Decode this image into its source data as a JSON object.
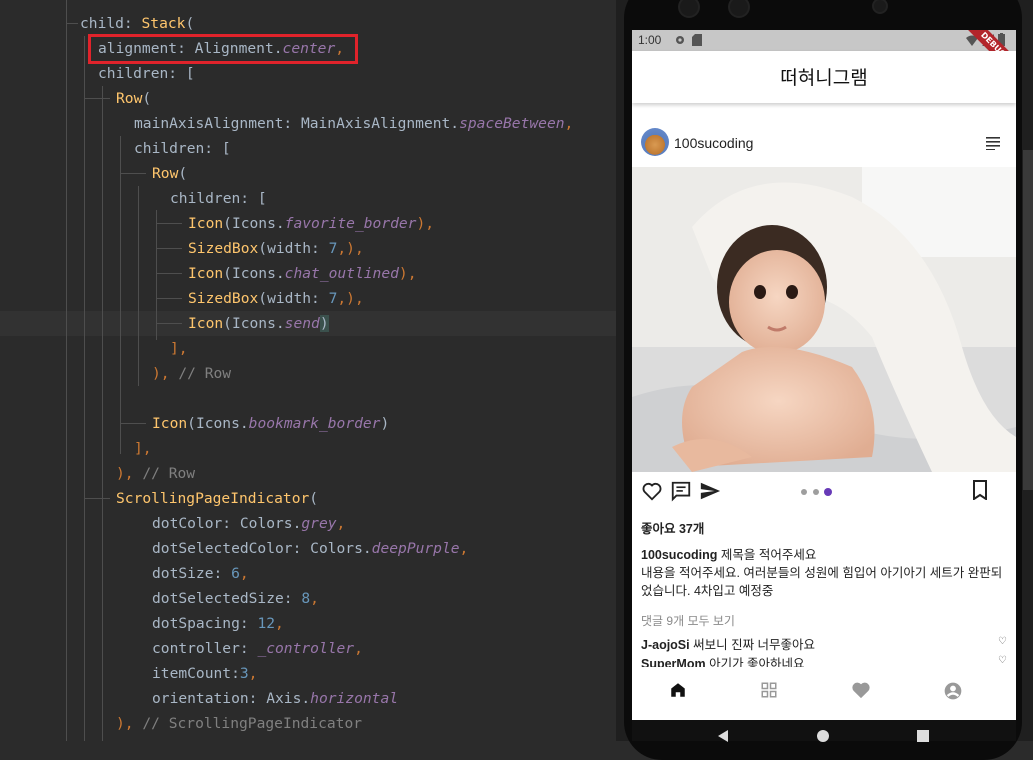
{
  "editor": {
    "lines": {
      "l1": {
        "prop": "child: ",
        "cls": "Stack",
        "rest": "("
      },
      "l2": {
        "prop": "alignment: ",
        "cls": "Alignment.",
        "it": "center",
        "rest": ","
      },
      "l3": {
        "prop": "children: ["
      },
      "l4": {
        "cls": "Row",
        "rest": "("
      },
      "l5": {
        "prop": "mainAxisAlignment: ",
        "cls": "MainAxisAlignment.",
        "it": "spaceBetween",
        "rest": ","
      },
      "l6": {
        "prop": "children: ["
      },
      "l7": {
        "cls": "Row",
        "rest": "("
      },
      "l8": {
        "prop": "children: ["
      },
      "l9": {
        "cls": "Icon",
        "a": "(Icons.",
        "it": "favorite_border",
        "rest": "),"
      },
      "l10": {
        "cls": "SizedBox",
        "a": "(width: ",
        "num": "7",
        "rest": ",),"
      },
      "l11": {
        "cls": "Icon",
        "a": "(Icons.",
        "it": "chat_outlined",
        "rest": "),"
      },
      "l12": {
        "cls": "SizedBox",
        "a": "(width: ",
        "num": "7",
        "rest": ",),"
      },
      "l13": {
        "cls": "Icon",
        "a": "(Icons.",
        "it": "send",
        "rest": ")"
      },
      "l14": {
        "rest": "],"
      },
      "l15": {
        "rest": "), ",
        "cm": "// Row"
      },
      "l17": {
        "cls": "Icon",
        "a": "(Icons.",
        "it": "bookmark_border",
        "rest": ")"
      },
      "l18": {
        "rest": "],"
      },
      "l19": {
        "rest": "), ",
        "cm": "// Row"
      },
      "l20": {
        "cls": "ScrollingPageIndicator",
        "rest": "("
      },
      "l21": {
        "prop": "dotColor: ",
        "a": "Colors.",
        "it": "grey",
        "rest": ","
      },
      "l22": {
        "prop": "dotSelectedColor: ",
        "a": "Colors.",
        "it": "deepPurple",
        "rest": ","
      },
      "l23": {
        "prop": "dotSize: ",
        "num": "6",
        "rest": ","
      },
      "l24": {
        "prop": "dotSelectedSize: ",
        "num": "8",
        "rest": ","
      },
      "l25": {
        "prop": "dotSpacing: ",
        "num": "12",
        "rest": ","
      },
      "l26": {
        "prop": "controller: ",
        "it": "_controller",
        "rest": ","
      },
      "l27": {
        "prop": "itemCount:",
        "num": "3",
        "rest": ","
      },
      "l28": {
        "prop": "orientation: ",
        "a": "Axis.",
        "it": "horizontal"
      },
      "l29": {
        "rest": "), ",
        "cm": "// ScrollingPageIndicator"
      }
    }
  },
  "phone": {
    "status_time": "1:00",
    "debug_label": "DEBUG",
    "app_title": "떠혀니그램",
    "username": "100sucoding",
    "likes": "좋아요 37개",
    "caption_user": "100sucoding",
    "caption_title": "제목을 적어주세요",
    "caption_body": "내용을 적어주세요. 여러분들의 성원에 힘입어 아기아기 세트가 완판되었습니다. 4차입고 예정중",
    "view_comments": "댓글 9개 모두 보기",
    "comments": [
      {
        "user": "J-aojoSi",
        "text": "써보니 진짜 너무좋아요"
      },
      {
        "user": "SuperMom",
        "text": "아기가 좋아하네요"
      }
    ],
    "indicator": {
      "count": 3,
      "selected_index": 2,
      "dot_color": "#9e9e9e",
      "selected_color": "#673ab7"
    }
  }
}
